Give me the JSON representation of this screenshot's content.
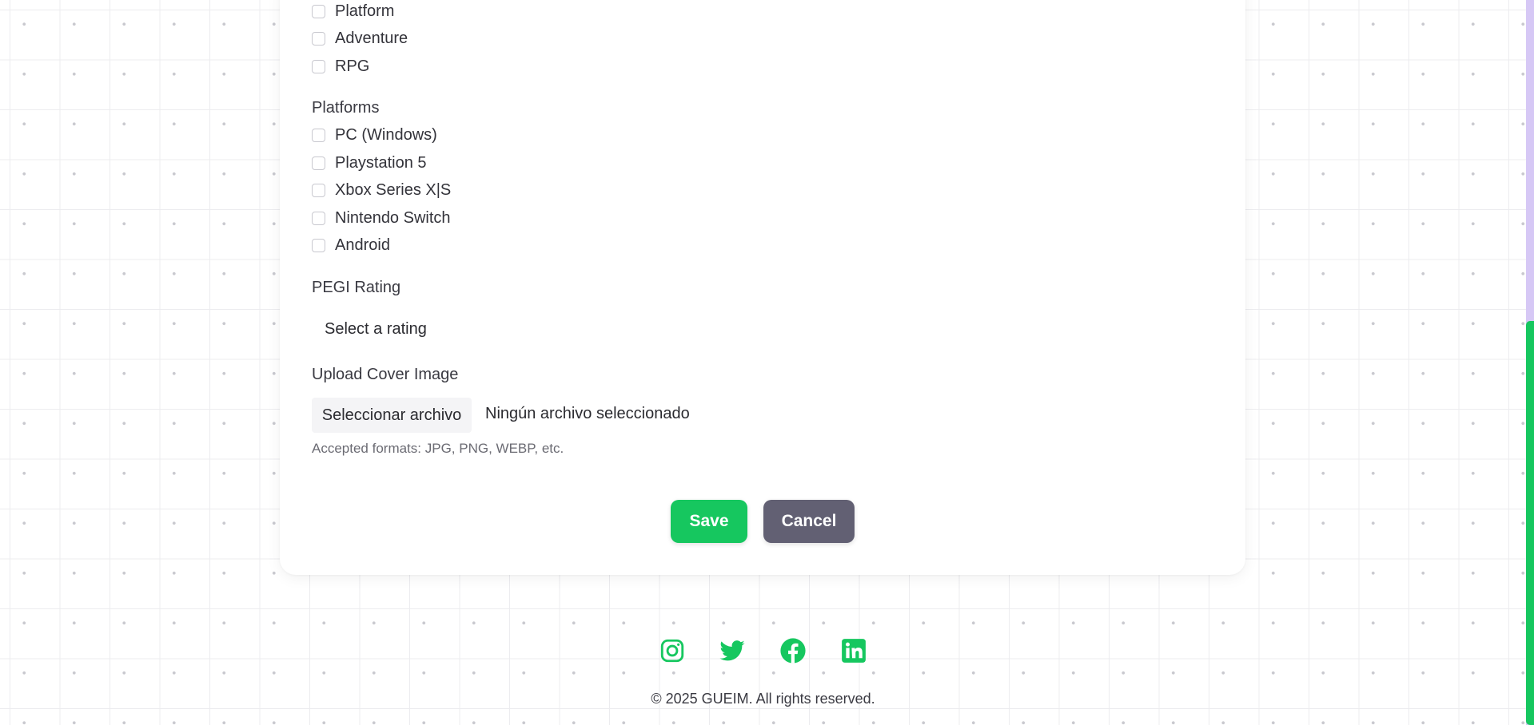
{
  "genres": {
    "items": [
      "Platform",
      "Adventure",
      "RPG"
    ]
  },
  "platforms": {
    "label": "Platforms",
    "items": [
      "PC (Windows)",
      "Playstation 5",
      "Xbox Series X|S",
      "Nintendo Switch",
      "Android"
    ]
  },
  "pegi": {
    "label": "PEGI Rating",
    "selected": "Select a rating"
  },
  "cover": {
    "label": "Upload Cover Image",
    "button_label": "Seleccionar archivo",
    "status": "Ningún archivo seleccionado",
    "help": "Accepted formats: JPG, PNG, WEBP, etc."
  },
  "actions": {
    "save_label": "Save",
    "cancel_label": "Cancel"
  },
  "footer": {
    "social_icons": [
      "instagram-icon",
      "twitter-icon",
      "facebook-icon",
      "linkedin-icon"
    ],
    "copyright": "© 2025 GUEIM. All rights reserved."
  },
  "colors": {
    "accent": "#16c75f",
    "cancel": "#626073",
    "scroll_track": "#d6c8f5"
  }
}
